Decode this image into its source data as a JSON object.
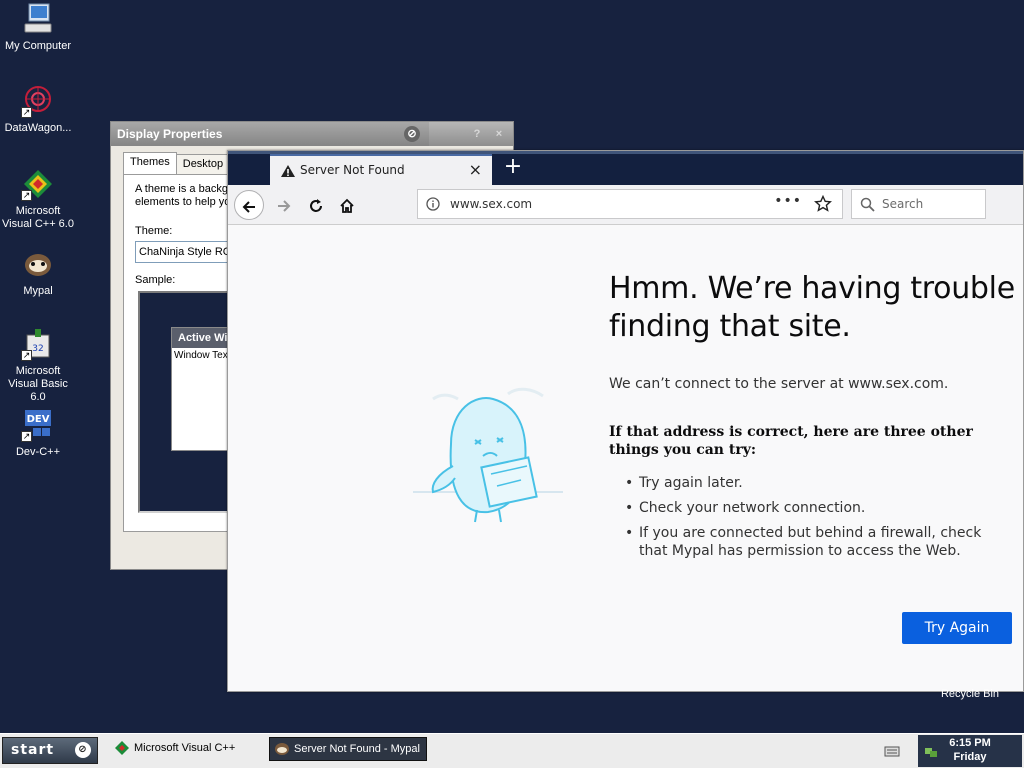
{
  "desktop": {
    "icons": [
      {
        "label": "My Computer",
        "icon": "computer-icon"
      },
      {
        "label": "DataWagon...",
        "icon": "datawagon-icon"
      },
      {
        "label": "Microsoft Visual C++ 6.0",
        "icon": "visual-cpp-icon"
      },
      {
        "label": "Mypal",
        "icon": "mypal-icon"
      },
      {
        "label": "Microsoft Visual Basic 6.0",
        "icon": "visual-basic-icon"
      },
      {
        "label": "Dev-C++",
        "icon": "dev-cpp-icon"
      }
    ],
    "recycle_label": "Recycle Bin"
  },
  "display_properties": {
    "title": "Display Properties",
    "help": "?",
    "close": "×",
    "tabs": [
      "Themes",
      "Desktop"
    ],
    "description": "A theme is a background plus a set of sounds, icons, and other elements to help you personalize your computer with one click.",
    "theme_label": "Theme:",
    "theme_value": "ChaNinja Style RC",
    "sample_label": "Sample:",
    "sample_window_title": "Active Window",
    "sample_window_text": "Window Text"
  },
  "browser": {
    "tab_title": "Server Not Found",
    "tab_close": "×",
    "new_tab": "+",
    "url": "www.sex.com",
    "url_more": "•••",
    "search_placeholder": "Search",
    "error": {
      "title": "Hmm. We’re having trouble finding that site.",
      "description": "We can’t connect to the server at www.sex.com.",
      "subtitle": "If that address is correct, here are three other things you can try:",
      "suggestions": [
        "Try again later.",
        "Check your network connection.",
        "If you are connected but behind a firewall, check that Mypal has permission to access the Web."
      ],
      "button": "Try Again"
    }
  },
  "taskbar": {
    "start_label": "start",
    "items": [
      {
        "label": "Microsoft Visual C++",
        "active": false
      },
      {
        "label": "Server Not Found - Mypal",
        "active": true
      }
    ],
    "clock_time": "6:15 PM",
    "clock_day": "Friday"
  },
  "colors": {
    "desktop": "#17223f",
    "accent_button": "#0a60df",
    "taskbar": "#ececec"
  }
}
